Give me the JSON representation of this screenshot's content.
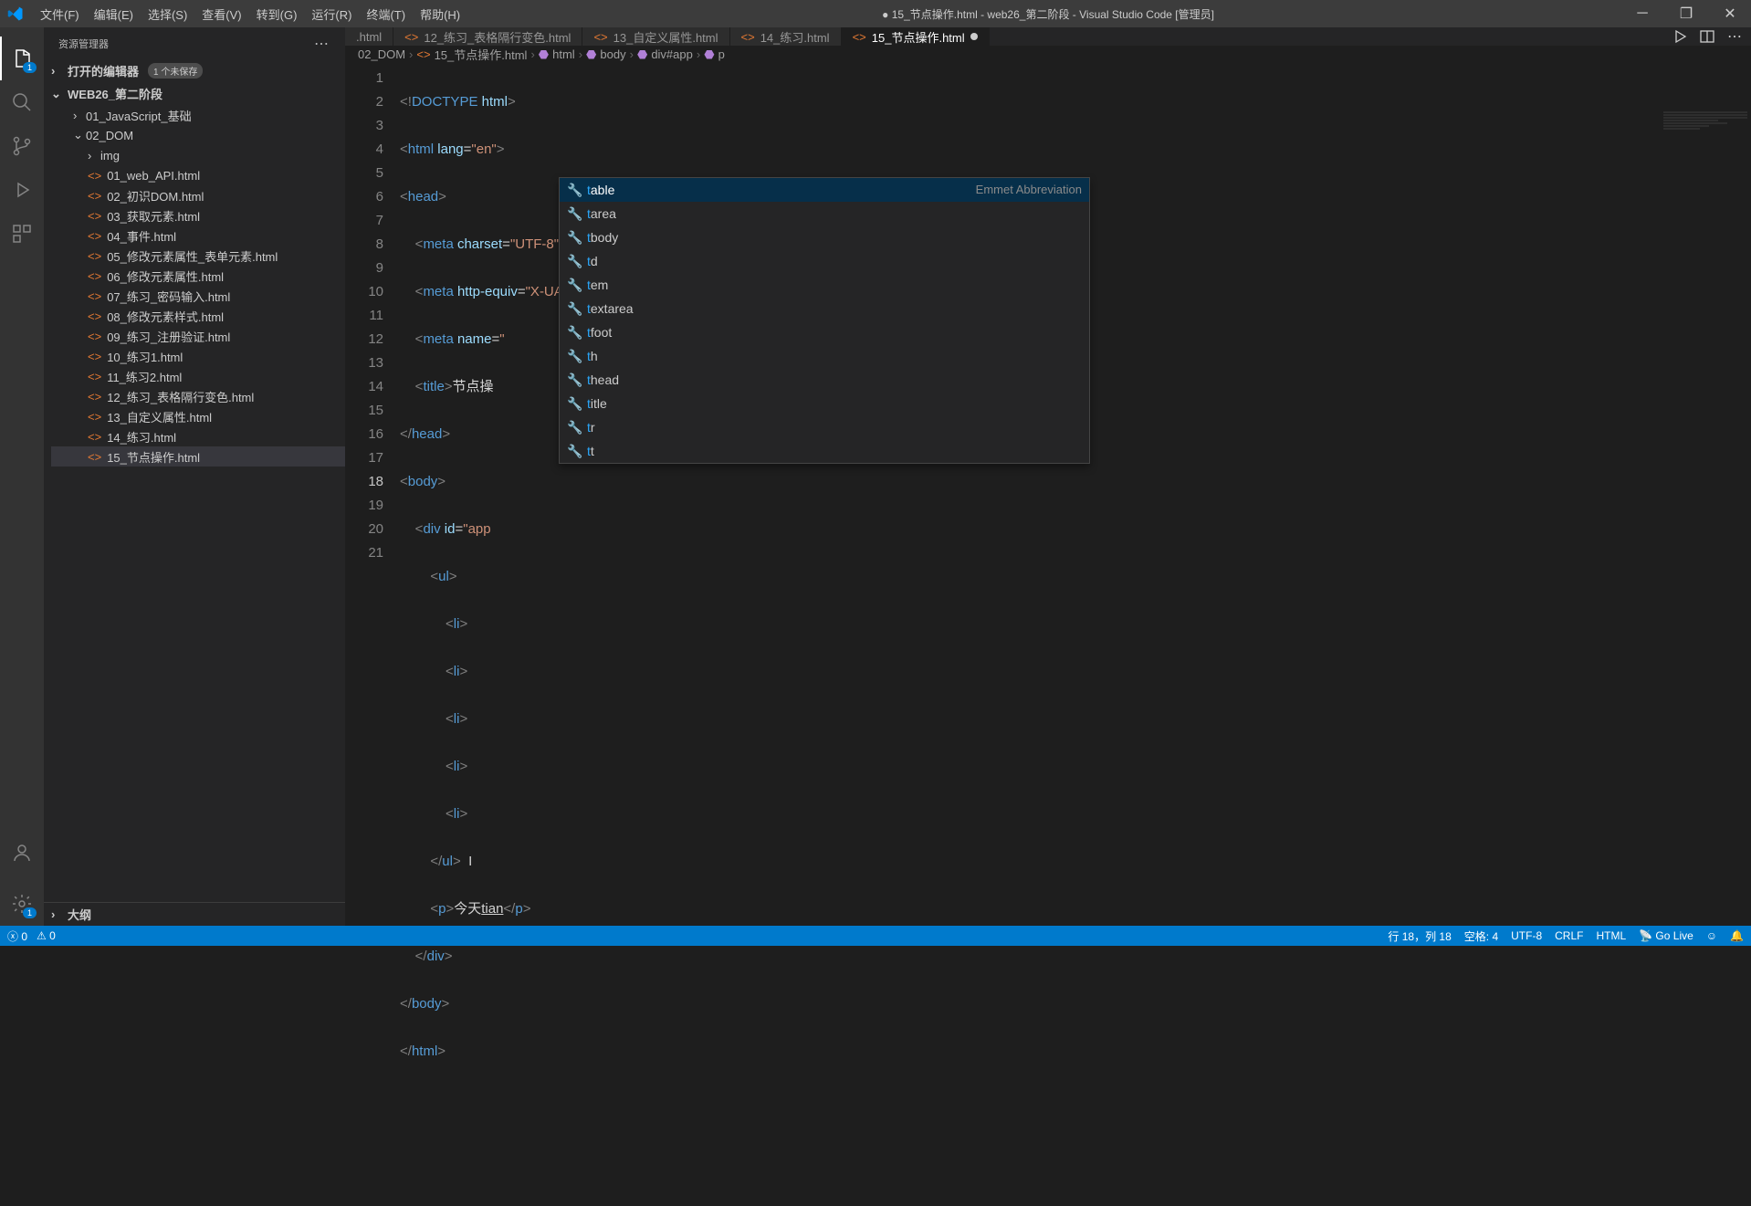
{
  "titlebar": {
    "menus": [
      "文件(F)",
      "编辑(E)",
      "选择(S)",
      "查看(V)",
      "转到(G)",
      "运行(R)",
      "终端(T)",
      "帮助(H)"
    ],
    "title": "● 15_节点操作.html - web26_第二阶段 - Visual Studio Code [管理员]"
  },
  "activity": {
    "badge_explorer": "1",
    "badge_settings": "1"
  },
  "sidebar": {
    "title": "资源管理器",
    "open_editors": "打开的编辑器",
    "open_editors_badge": "1 个未保存",
    "workspace": "WEB26_第二阶段",
    "folders": [
      {
        "name": "01_JavaScript_基础",
        "depth": 1,
        "expanded": false
      },
      {
        "name": "02_DOM",
        "depth": 1,
        "expanded": true
      },
      {
        "name": "img",
        "depth": 2,
        "expanded": false
      }
    ],
    "files": [
      "01_web_API.html",
      "02_初识DOM.html",
      "03_获取元素.html",
      "04_事件.html",
      "05_修改元素属性_表单元素.html",
      "06_修改元素属性.html",
      "07_练习_密码输入.html",
      "08_修改元素样式.html",
      "09_练习_注册验证.html",
      "10_练习1.html",
      "11_练习2.html",
      "12_练习_表格隔行变色.html",
      "13_自定义属性.html",
      "14_练习.html",
      "15_节点操作.html"
    ],
    "active_file": "15_节点操作.html",
    "outline": "大纲"
  },
  "tabs": {
    "items": [
      {
        "label": ".html",
        "modified": false,
        "partial": true
      },
      {
        "label": "12_练习_表格隔行变色.html",
        "modified": false
      },
      {
        "label": "13_自定义属性.html",
        "modified": false
      },
      {
        "label": "14_练习.html",
        "modified": false
      },
      {
        "label": "15_节点操作.html",
        "modified": true,
        "active": true
      }
    ]
  },
  "breadcrumb": {
    "parts": [
      "02_DOM",
      "15_节点操作.html",
      "html",
      "body",
      "div#app",
      "p"
    ]
  },
  "code": {
    "line_count": 21,
    "active_line": 18,
    "lines": {
      "l1": "<!DOCTYPE html>",
      "l3_open": "<head>",
      "l7_title_text": "节点操",
      "l8_close": "</head>",
      "l9_open": "<body>",
      "l18_text": "今天",
      "l18_typed": "tian",
      "l19_close": "</div>",
      "l20_close": "</body>",
      "l21_close": "</html>"
    }
  },
  "suggest": {
    "hint": "Emmet Abbreviation",
    "items": [
      "table",
      "tarea",
      "tbody",
      "td",
      "tem",
      "textarea",
      "tfoot",
      "th",
      "thead",
      "title",
      "tr",
      "tt"
    ]
  },
  "status": {
    "errors": "0",
    "warnings": "0",
    "cursor": "行 18，列 18",
    "spaces": "空格: 4",
    "encoding": "UTF-8",
    "eol": "CRLF",
    "lang": "HTML",
    "golive": "Go Live",
    "bell": "🔔"
  }
}
